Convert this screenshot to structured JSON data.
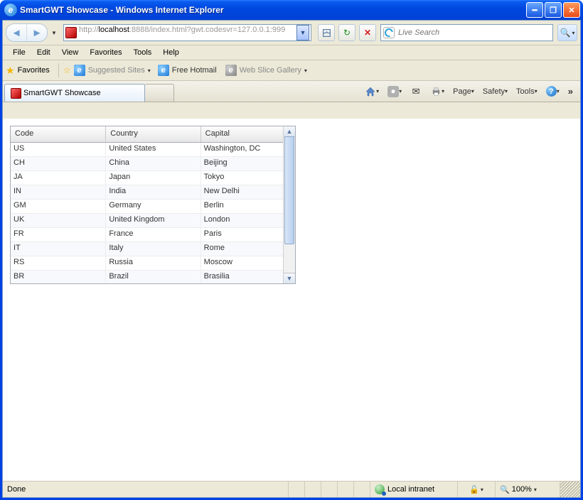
{
  "window": {
    "title": "SmartGWT Showcase - Windows Internet Explorer"
  },
  "address": {
    "protocol": "http://",
    "host": "localhost",
    "rest": ":8888/index.html?gwt.codesvr=127.0.0.1:999"
  },
  "search": {
    "placeholder": "Live Search"
  },
  "menubar": [
    "File",
    "Edit",
    "View",
    "Favorites",
    "Tools",
    "Help"
  ],
  "favbar": {
    "label": "Favorites",
    "suggested": "Suggested Sites",
    "hotmail": "Free Hotmail",
    "slice": "Web Slice Gallery"
  },
  "tab": {
    "active": "SmartGWT Showcase"
  },
  "cmd": {
    "page": "Page",
    "safety": "Safety",
    "tools": "Tools"
  },
  "grid": {
    "headers": {
      "code": "Code",
      "country": "Country",
      "capital": "Capital"
    },
    "rows": [
      {
        "code": "US",
        "country": "United States",
        "capital": "Washington, DC"
      },
      {
        "code": "CH",
        "country": "China",
        "capital": "Beijing"
      },
      {
        "code": "JA",
        "country": "Japan",
        "capital": "Tokyo"
      },
      {
        "code": "IN",
        "country": "India",
        "capital": "New Delhi"
      },
      {
        "code": "GM",
        "country": "Germany",
        "capital": "Berlin"
      },
      {
        "code": "UK",
        "country": "United Kingdom",
        "capital": "London"
      },
      {
        "code": "FR",
        "country": "France",
        "capital": "Paris"
      },
      {
        "code": "IT",
        "country": "Italy",
        "capital": "Rome"
      },
      {
        "code": "RS",
        "country": "Russia",
        "capital": "Moscow"
      },
      {
        "code": "BR",
        "country": "Brazil",
        "capital": "Brasilia"
      }
    ]
  },
  "status": {
    "done": "Done",
    "zone": "Local intranet",
    "zoom": "100%"
  }
}
